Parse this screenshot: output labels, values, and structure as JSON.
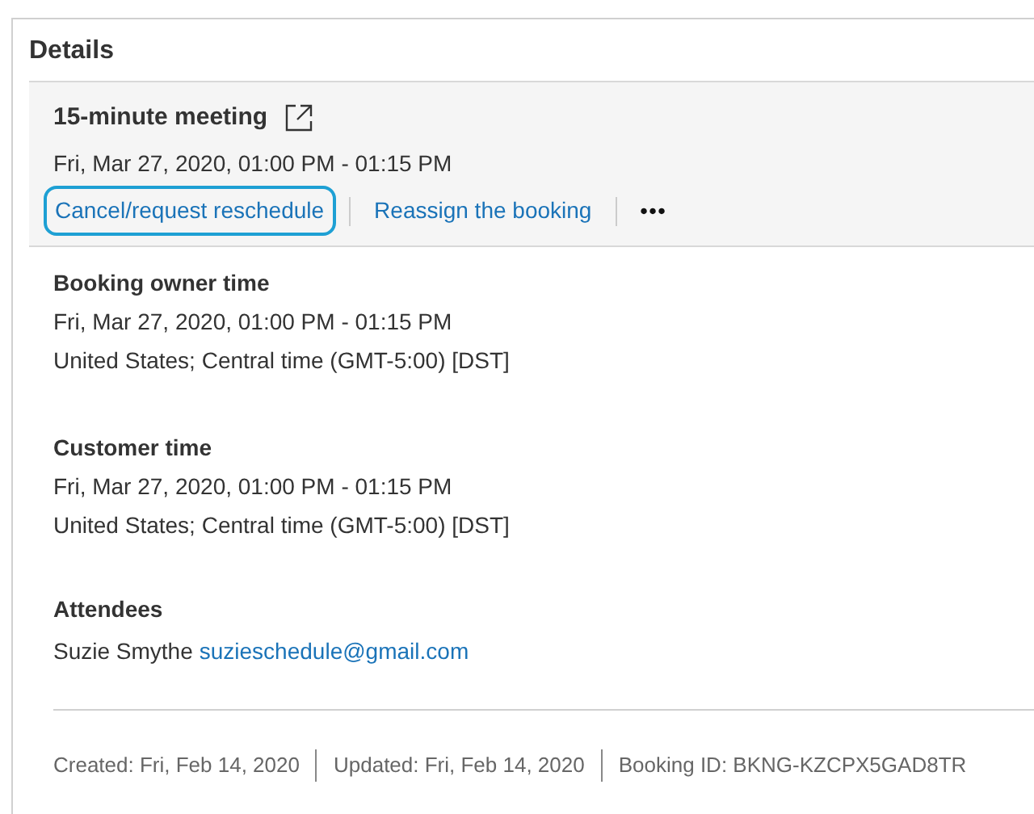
{
  "title": "Details",
  "booking": {
    "name": "15-minute meeting",
    "time": "Fri, Mar 27, 2020, 01:00 PM - 01:15 PM",
    "actions": [
      {
        "label": "Cancel/request reschedule",
        "focused": true
      },
      {
        "label": "Reassign the booking",
        "focused": false
      }
    ],
    "more": "•••"
  },
  "sections": [
    {
      "heading": "Booking owner time",
      "lines": [
        "Fri, Mar 27, 2020, 01:00 PM - 01:15 PM",
        "United States; Central time (GMT-5:00) [DST]"
      ]
    },
    {
      "heading": "Customer time",
      "lines": [
        "Fri, Mar 27, 2020, 01:00 PM - 01:15 PM",
        "United States; Central time (GMT-5:00) [DST]"
      ]
    }
  ],
  "attendees": {
    "heading": "Attendees",
    "name": "Suzie Smythe",
    "email": "suzieschedule@gmail.com"
  },
  "footer": [
    "Created: Fri, Feb 14, 2020",
    "Updated: Fri, Feb 14, 2020",
    "Booking ID: BKNG-KZCPX5GAD8TR"
  ]
}
